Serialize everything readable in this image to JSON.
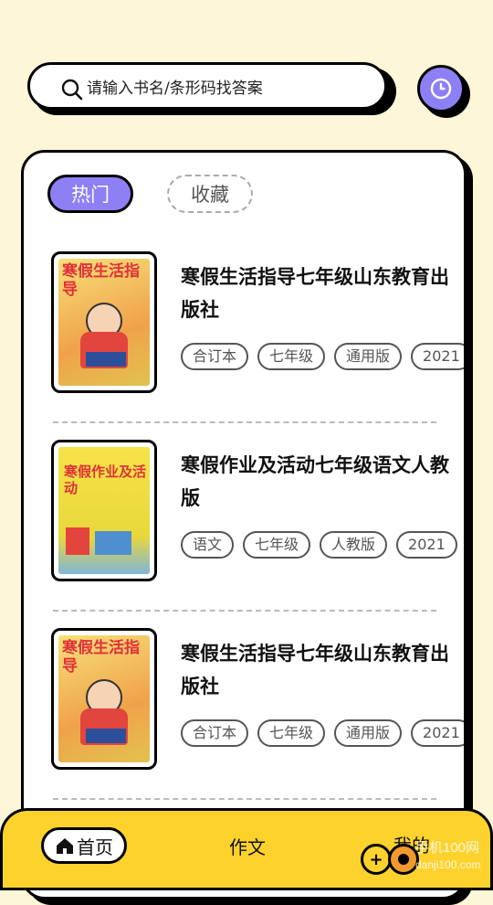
{
  "search": {
    "placeholder": "请输入书名/条形码找答案"
  },
  "tabs": {
    "hot": "热门",
    "favorites": "收藏"
  },
  "books": [
    {
      "title": "寒假生活指导七年级山东教育出版社",
      "cover_text": "寒假生活指导",
      "tags": [
        "合订本",
        "七年级",
        "通用版",
        "2021"
      ]
    },
    {
      "title": "寒假作业及活动七年级语文人教版",
      "cover_text": "寒假作业及活动",
      "tags": [
        "语文",
        "七年级",
        "人教版",
        "2021"
      ]
    },
    {
      "title": "寒假生活指导七年级山东教育出版社",
      "cover_text": "寒假生活指导",
      "tags": [
        "合订本",
        "七年级",
        "通用版",
        "2021"
      ]
    }
  ],
  "nav": {
    "home": "首页",
    "essay": "作文",
    "mine": "我的"
  },
  "watermark": {
    "line1": "手机100网",
    "line2": "danji100.com"
  },
  "colors": {
    "accent": "#8d80f5",
    "nav_bg": "#fdd22c",
    "page_bg": "#fdf6d8"
  }
}
